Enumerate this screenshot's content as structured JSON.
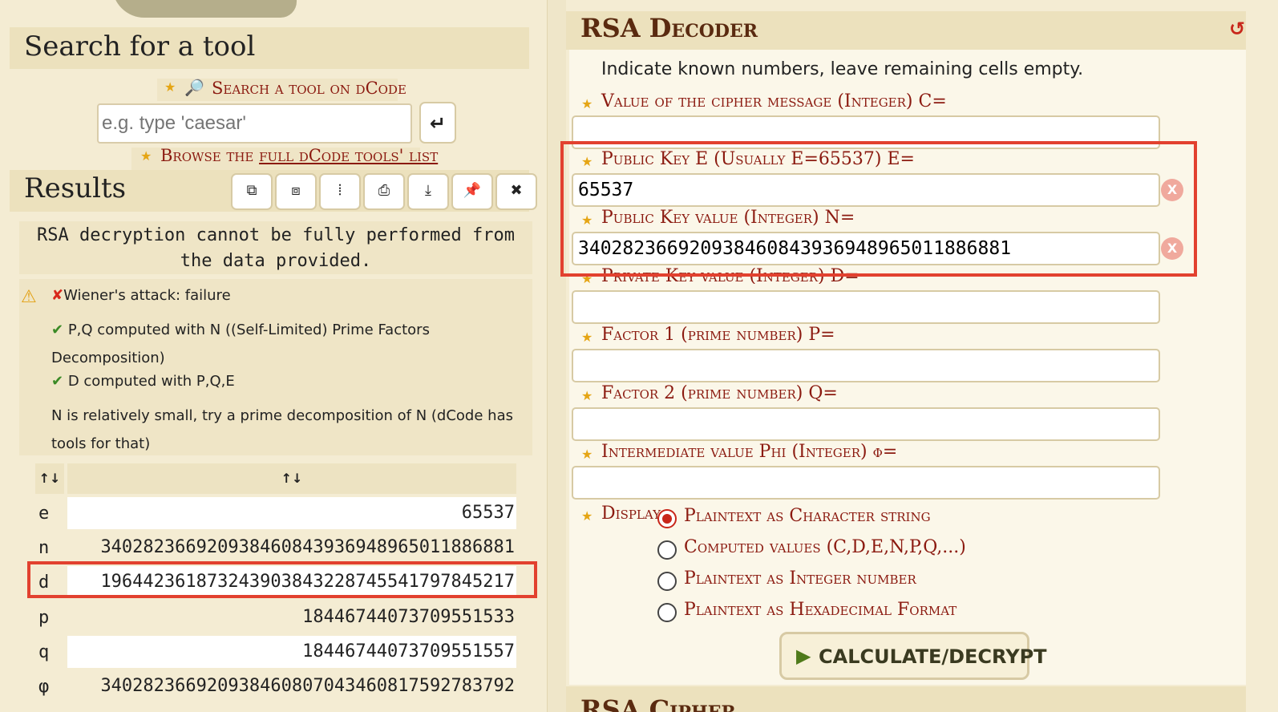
{
  "search": {
    "title": "Search for a tool",
    "search_link": "Search a tool on dCode",
    "placeholder": "e.g. type 'caesar'",
    "enter_icon": "↵",
    "browse_prefix": "Browse the ",
    "browse_link": "full dCode tools' list"
  },
  "results": {
    "title": "Results",
    "toolbar": [
      "⧉",
      "⧈",
      "⦙",
      "⎙",
      "⤓",
      "📌",
      "✖"
    ],
    "message": "RSA decryption cannot be fully performed from the data provided.",
    "log": [
      {
        "mark": "✘",
        "text": "Wiener's attack: failure"
      },
      {
        "mark": "✔",
        "text": "P,Q computed with N ((Self-Limited) Prime Factors Decomposition)"
      },
      {
        "mark": "✔",
        "text": "D computed with P,Q,E"
      },
      {
        "mark": "",
        "text": "N is relatively small, try a prime decomposition of N (dCode has tools for that)"
      }
    ],
    "table_headers": [
      "↑↓",
      "↑↓"
    ],
    "rows": [
      {
        "key": "e",
        "value": "65537"
      },
      {
        "key": "n",
        "value": "340282366920938460843936948965011886881"
      },
      {
        "key": "d",
        "value": "196442361873243903843228745541797845217"
      },
      {
        "key": "p",
        "value": "18446744073709551533"
      },
      {
        "key": "q",
        "value": "18446744073709551557"
      },
      {
        "key": "φ",
        "value": "340282366920938460807043460817592783792"
      }
    ]
  },
  "decoder": {
    "title": "RSA Decoder",
    "reload_icon": "↺",
    "intro": "Indicate known numbers, leave remaining cells empty.",
    "fields": [
      {
        "label": "Value of the cipher message (Integer) C=",
        "value": ""
      },
      {
        "label": "Public Key E (Usually E=65537) E=",
        "value": "65537"
      },
      {
        "label": "Public Key value (Integer) N=",
        "value": "340282366920938460843936948965011886881"
      },
      {
        "label": "Private Key value (Integer) D=",
        "value": ""
      },
      {
        "label": "Factor 1 (prime number) P=",
        "value": ""
      },
      {
        "label": "Factor 2 (prime number) Q=",
        "value": ""
      },
      {
        "label": "Intermediate value Phi (Integer) φ=",
        "value": ""
      }
    ],
    "clear_icon": "X",
    "display_label": "Display",
    "options": [
      {
        "label": "Plaintext as Character string",
        "selected": true
      },
      {
        "label": "Computed values (C,D,E,N,P,Q,...)",
        "selected": false
      },
      {
        "label": "Plaintext as Integer number",
        "selected": false
      },
      {
        "label": "Plaintext as Hexadecimal Format",
        "selected": false
      }
    ],
    "submit": "CALCULATE/DECRYPT",
    "next_section": "RSA Cipher"
  },
  "colors": {
    "accent": "#8b1a10",
    "highlight": "#e2412f",
    "background": "#f4ecd3"
  }
}
